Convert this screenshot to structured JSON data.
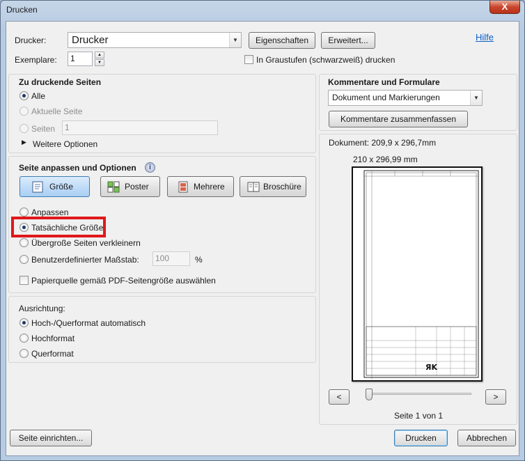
{
  "window": {
    "title": "Drucken",
    "close_label": "X"
  },
  "printer": {
    "label": "Drucker:",
    "value": "Drucker",
    "properties_button": "Eigenschaften",
    "advanced_button": "Erweitert...",
    "help_link": "Hilfe",
    "copies_label": "Exemplare:",
    "copies_value": "1",
    "grayscale_label": "In Graustufen (schwarzweiß) drucken"
  },
  "pages_to_print": {
    "title": "Zu druckende Seiten",
    "options": [
      "Alle",
      "Aktuelle Seite",
      "Seiten"
    ],
    "pages_value": "1",
    "more_options": "Weitere Optionen"
  },
  "page_sizing": {
    "title": "Seite anpassen und Optionen",
    "modes": [
      "Größe",
      "Poster",
      "Mehrere",
      "Broschüre"
    ],
    "options": [
      "Anpassen",
      "Tatsächliche Größe",
      "Übergroße Seiten verkleinern",
      "Benutzerdefinierter Maßstab:"
    ],
    "scale_value": "100",
    "scale_unit": "%",
    "paper_source_label": "Papierquelle gemäß PDF-Seitengröße auswählen"
  },
  "orientation": {
    "title": "Ausrichtung:",
    "options": [
      "Hoch-/Querformat automatisch",
      "Hochformat",
      "Querformat"
    ]
  },
  "comments": {
    "title": "Kommentare und Formulare",
    "value": "Dokument und Markierungen",
    "summarize_button": "Kommentare zusammenfassen"
  },
  "preview": {
    "document_size": "Dokument: 209,9 x 296,7mm",
    "page_size": "210 x 296,99 mm",
    "page_indicator": "Seite 1 von 1",
    "prev_label": "<",
    "next_label": ">",
    "slider_position": 0
  },
  "footer": {
    "page_setup_button": "Seite einrichten...",
    "print_button": "Drucken",
    "cancel_button": "Abbrechen"
  },
  "colors": {
    "highlight": "#e0181b",
    "link": "#0b5fc6"
  }
}
